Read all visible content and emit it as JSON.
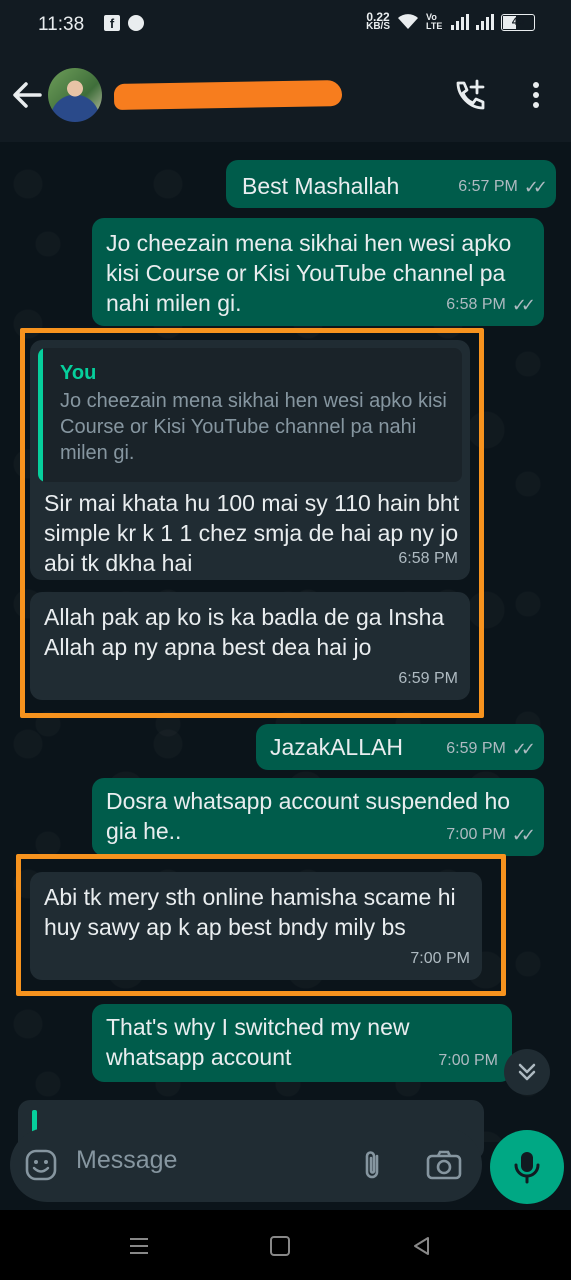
{
  "status_bar": {
    "time": "11:38",
    "speed_value": "0.22",
    "speed_unit": "KB/S",
    "network_label": "Vo LTE",
    "battery": "40"
  },
  "header": {
    "contact_name": "[redacted]"
  },
  "messages": [
    {
      "direction": "out",
      "text": "Best Mashallah",
      "time": "6:57 PM",
      "status": "read"
    },
    {
      "direction": "out",
      "text": "Jo cheezain mena sikhai hen wesi apko kisi Course or Kisi YouTube channel pa nahi milen gi.",
      "time": "6:58 PM",
      "status": "read"
    },
    {
      "direction": "in",
      "quote_author": "You",
      "quote_text": "Jo cheezain mena sikhai hen wesi apko kisi Course or Kisi YouTube channel pa nahi milen gi.",
      "text": "Sir mai khata hu 100 mai sy 110 hain bht simple kr k 1 1 chez smja de hai ap ny jo abi tk dkha hai",
      "time": "6:58 PM"
    },
    {
      "direction": "in",
      "text": "Allah pak ap ko is ka badla de ga Insha Allah ap ny apna best dea hai jo",
      "time": "6:59 PM"
    },
    {
      "direction": "out",
      "text": "JazakALLAH",
      "time": "6:59 PM",
      "status": "read"
    },
    {
      "direction": "out",
      "text": "Dosra whatsapp account suspended ho gia he..",
      "time": "7:00 PM",
      "status": "read"
    },
    {
      "direction": "in",
      "text": "Abi tk mery sth online hamisha scame hi huy sawy ap k ap best bndy mily bs",
      "time": "7:00 PM"
    },
    {
      "direction": "out",
      "text": "That's why I switched my new whatsapp account",
      "time": "7:00 PM",
      "status": "read"
    }
  ],
  "composer": {
    "placeholder": "Message"
  },
  "icons": [
    "back-arrow-icon",
    "avatar",
    "add-call-icon",
    "more-vert-icon",
    "emoji-icon",
    "attach-icon",
    "camera-icon",
    "mic-icon",
    "chevron-double-down-icon"
  ],
  "colors": {
    "outgoing_bubble": "#005c4b",
    "incoming_bubble": "#202c33",
    "accent": "#00a884",
    "highlight": "#f7931e",
    "redaction": "#f77d1e"
  }
}
